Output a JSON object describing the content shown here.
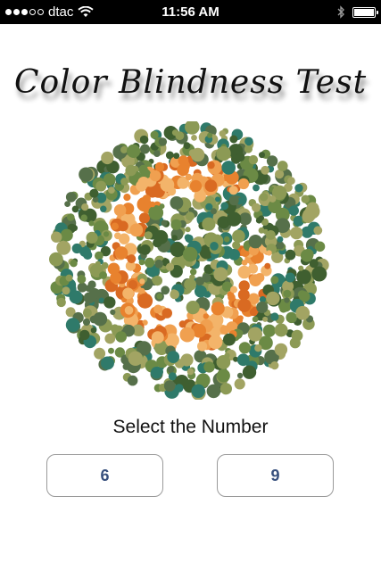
{
  "status_bar": {
    "carrier": "dtac",
    "time": "11:56 AM",
    "signal_bars_filled": 3,
    "signal_bars_total": 5
  },
  "app": {
    "title": "Color Blindness Test"
  },
  "test": {
    "plate_icon": "ishihara-plate",
    "prompt": "Select the Number",
    "options": [
      "6",
      "9"
    ]
  },
  "colors": {
    "option_text": "#37507d",
    "plate_figure": "#e8822e",
    "plate_background": [
      "#6b8a45",
      "#3f5f30",
      "#8c9a55",
      "#2f7a6a",
      "#a2a463",
      "#56704a"
    ]
  }
}
